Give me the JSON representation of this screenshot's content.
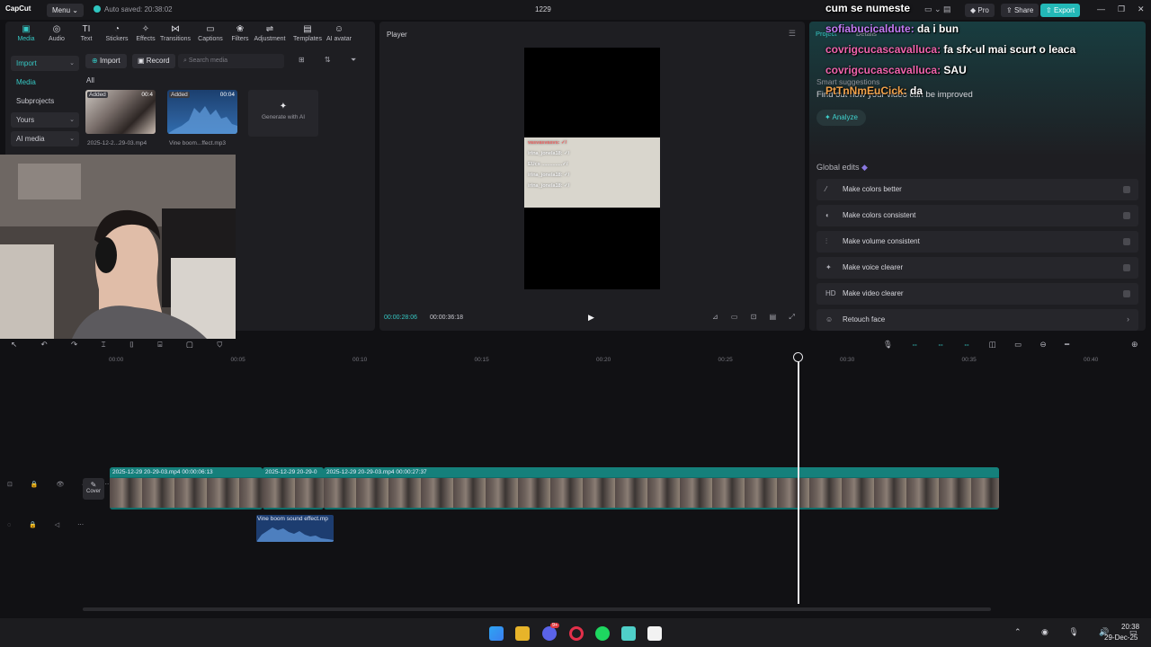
{
  "titlebar": {
    "logo": "CapCut",
    "menu": "Menu",
    "autosave": "Auto saved: 20:38:02",
    "project_name": "1229",
    "pro": "Pro",
    "share": "Share",
    "export": "Export"
  },
  "toolbar": [
    {
      "label": "Media",
      "icon": "media-icon",
      "glyph": "▣"
    },
    {
      "label": "Audio",
      "icon": "audio-icon",
      "glyph": "◎"
    },
    {
      "label": "Text",
      "icon": "text-icon",
      "glyph": "TI"
    },
    {
      "label": "Stickers",
      "icon": "stickers-icon",
      "glyph": "◔"
    },
    {
      "label": "Effects",
      "icon": "effects-icon",
      "glyph": "✧"
    },
    {
      "label": "Transitions",
      "icon": "transitions-icon",
      "glyph": "⋈"
    },
    {
      "label": "Captions",
      "icon": "captions-icon",
      "glyph": "▭"
    },
    {
      "label": "Filters",
      "icon": "filters-icon",
      "glyph": "❀"
    },
    {
      "label": "Adjustment",
      "icon": "adjustment-icon",
      "glyph": "⇌"
    },
    {
      "label": "Templates",
      "icon": "templates-icon",
      "glyph": "▤"
    },
    {
      "label": "AI avatar",
      "icon": "ai-avatar-icon",
      "glyph": "☺"
    }
  ],
  "side_nav": {
    "import": "Import",
    "media": "Media",
    "subprojects": "Subprojects",
    "yours": "Yours",
    "ai_media": "AI media"
  },
  "media": {
    "import_btn": "Import",
    "record_btn": "Record",
    "search_placeholder": "Search media",
    "all": "All",
    "items": [
      {
        "badge": "Added",
        "duration": "00:4",
        "caption": "2025-12-2...29-03.mp4"
      },
      {
        "badge": "Added",
        "duration": "00:04",
        "caption": "Vine boom...ffect.mp3"
      }
    ],
    "generate": "Generate with AI"
  },
  "player": {
    "title": "Player",
    "current": "00:00:28:06",
    "total": "00:00:36:18",
    "chat_lines": [
      "vasvasvasvs: ✓/",
      "irina_jonela18: ✓/",
      "EUcs ...............✓/",
      "irina_jonela18: ✓/",
      "irina_jonela18: ✓/"
    ]
  },
  "right_panel": {
    "tab_project": "Project",
    "tab_details": "Details",
    "smart_title": "Smart suggestions",
    "smart_sub": "Find out how your video can be improved",
    "analyze": "Analyze",
    "global_title": "Global edits",
    "global_items": [
      {
        "label": "Make colors better",
        "icon": "wand-icon",
        "glyph": "⁄"
      },
      {
        "label": "Make colors consistent",
        "icon": "palette-icon",
        "glyph": "◐"
      },
      {
        "label": "Make volume consistent",
        "icon": "equalizer-icon",
        "glyph": "⫶"
      },
      {
        "label": "Make voice clearer",
        "icon": "voice-icon",
        "glyph": "✦"
      },
      {
        "label": "Make video clearer",
        "icon": "hd-icon",
        "glyph": "HD"
      },
      {
        "label": "Retouch face",
        "icon": "face-icon",
        "glyph": "☺"
      }
    ]
  },
  "chat_overlay": [
    {
      "user": "",
      "msg": "cum se numeste",
      "cls": ""
    },
    {
      "user": "sofiabucicaldute:",
      "msg": "da i bun",
      "cls": "u1"
    },
    {
      "user": "covrigcucascavalluca:",
      "msg": "fa sfx-ul mai scurt o leaca",
      "cls": "u2"
    },
    {
      "user": "covrigcucascavalluca:",
      "msg": "SAU",
      "cls": "u2"
    },
    {
      "user": "PtTnNmEuCick:",
      "msg": "da",
      "cls": "u3"
    }
  ],
  "timeline": {
    "ticks": [
      "00:00",
      "00:05",
      "00:10",
      "00:15",
      "00:20",
      "00:25",
      "00:30",
      "00:35",
      "00:40"
    ],
    "cover": "Cover",
    "clips": [
      {
        "label": "2025-12-29 20-29-03.mp4   00:00:06:13"
      },
      {
        "label": "2025-12-29 20-29-0"
      },
      {
        "label": "2025-12-29 20-29-03.mp4   00:00:27:37"
      }
    ],
    "audio_clip": "Vine boom sound effect.mp"
  },
  "taskbar": {
    "time": "20:38",
    "date": "29-Dec-25",
    "discord_badge": "9+"
  },
  "colors": {
    "accent": "#36c8c4",
    "export": "#23b8b7",
    "clip": "#0f6e6a",
    "audio": "#1d3d70"
  }
}
